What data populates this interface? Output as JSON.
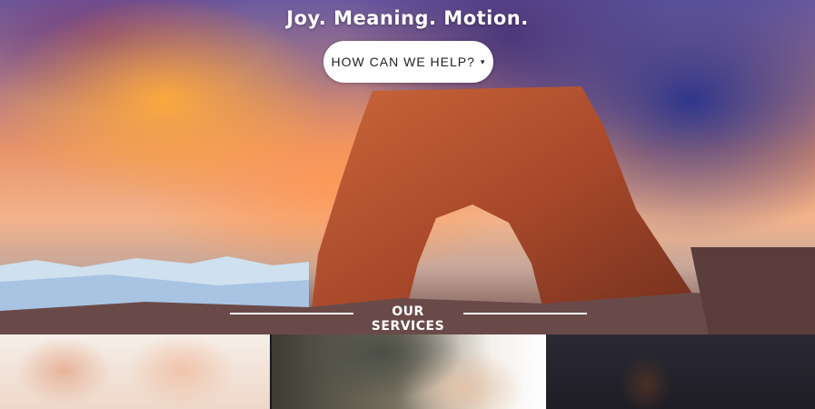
{
  "hero": {
    "headline": "Joy. Meaning. Motion.",
    "cta_label": "HOW CAN WE HELP?",
    "cta_caret": "▾"
  },
  "services": {
    "title": "OUR SERVICES"
  },
  "colors": {
    "text_on_image": "#ffffff",
    "button_bg": "#ffffff",
    "button_text": "#222222"
  }
}
